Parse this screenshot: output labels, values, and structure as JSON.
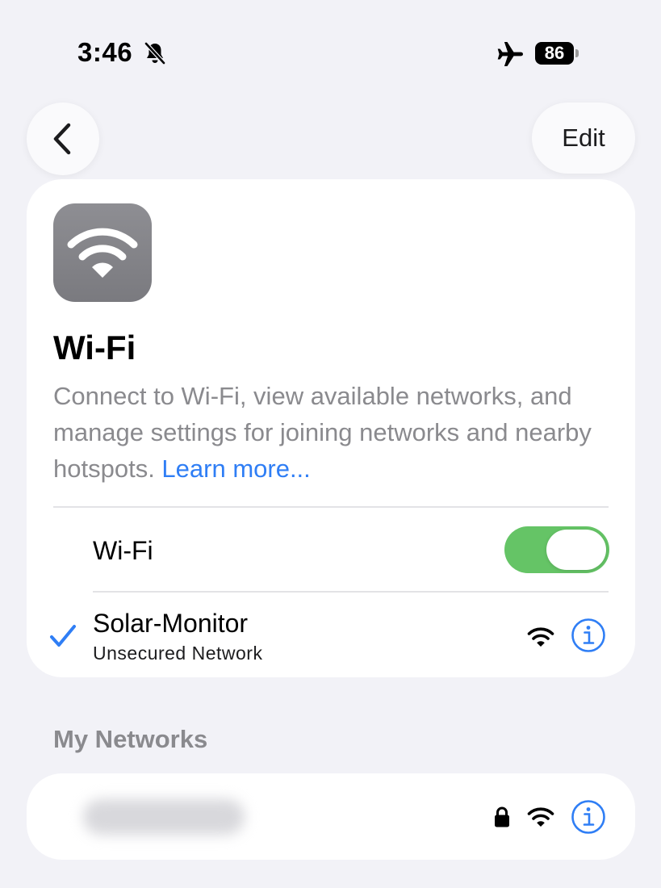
{
  "status_bar": {
    "time": "3:46",
    "battery": "86",
    "icons": [
      "bell-slash-icon",
      "airplane-icon"
    ]
  },
  "nav": {
    "back_icon": "chevron-left-icon",
    "edit_label": "Edit"
  },
  "header": {
    "icon": "wifi-icon",
    "title": "Wi-Fi",
    "description": "Connect to Wi-Fi, view available networks, and manage settings for joining networks and nearby hotspots. ",
    "learn_more": "Learn more..."
  },
  "wifi_toggle": {
    "label": "Wi-Fi",
    "on": true,
    "on_color": "#65c466"
  },
  "current_network": {
    "name": "Solar-Monitor",
    "subtitle": "Unsecured Network",
    "connected": true
  },
  "my_networks": {
    "header": "My Networks",
    "items": [
      {
        "name": "",
        "blurred": true,
        "secured": true
      }
    ]
  },
  "colors": {
    "accent": "#2f7ef5",
    "background": "#f2f2f7"
  }
}
